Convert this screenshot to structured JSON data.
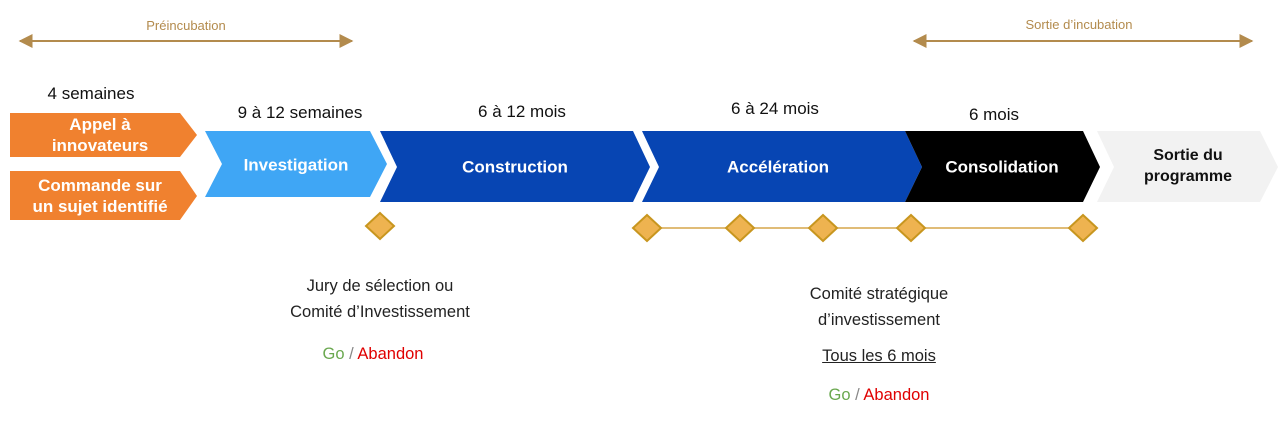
{
  "ranges": {
    "preincubation": "Préincubation",
    "sortie": "Sortie d’incubation"
  },
  "durations": {
    "entry": "4 semaines",
    "investigation": "9 à 12 semaines",
    "construction": "6 à 12 mois",
    "acceleration": "6 à 24 mois",
    "consolidation": "6 mois"
  },
  "entry": {
    "appel": [
      "Appel à",
      "innovateurs"
    ],
    "commande": [
      "Commande sur",
      "un sujet identifié"
    ]
  },
  "phases": {
    "investigation": "Investigation",
    "construction": "Construction",
    "acceleration": "Accélération",
    "consolidation": "Consolidation",
    "sortie": [
      "Sortie du",
      "programme"
    ]
  },
  "captions": {
    "left": {
      "line1": "Jury de sélection ou",
      "line2": "Comité d’Investissement",
      "go": "Go",
      "slash": "/",
      "abandon": "Abandon"
    },
    "right": {
      "line1": "Comité stratégique",
      "line2": "d’investissement",
      "frequency": "Tous les 6 mois",
      "go": "Go",
      "slash": "/",
      "abandon": "Abandon"
    }
  },
  "colors": {
    "orange": "#f0812f",
    "lightBlue": "#3fa6f5",
    "darkBlue": "#0745b3",
    "black": "#000000",
    "lightGray": "#f2f2f2",
    "gold": "#eeb350",
    "goldDark": "#c8961f",
    "goldArrow": "#b38b4d"
  }
}
